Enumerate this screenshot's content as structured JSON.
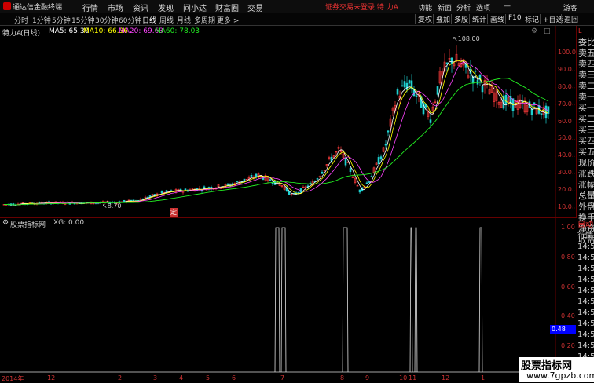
{
  "app": {
    "title": "通达信金融终端"
  },
  "menu": [
    "行情",
    "市场",
    "资讯",
    "发现",
    "问小达",
    "财富圈",
    "交易"
  ],
  "notice": "证券交易未登录   特 力A",
  "right_menu": [
    "功能",
    "新面",
    "分析",
    "选项",
    "游客"
  ],
  "periods": [
    "分时",
    "1分钟",
    "5分钟",
    "15分钟",
    "30分钟",
    "60分钟",
    "日线",
    "周线",
    "月线",
    "多周期",
    "更多 >"
  ],
  "active_period": "日线",
  "toolbar_buttons": [
    "复权",
    "叠加",
    "多股",
    "统计",
    "画线",
    "F10",
    "标记",
    "+自选",
    "返回"
  ],
  "stock": {
    "name": "特力A",
    "period": "(日线)"
  },
  "ma": [
    {
      "label": "MA5: 65.30",
      "color": "#ffffff"
    },
    {
      "label": "MA10: 66.36",
      "color": "#ffff00"
    },
    {
      "label": "MA20: 69.63",
      "color": "#ff44ff"
    },
    {
      "label": "MA60: 78.03",
      "color": "#22ee22"
    }
  ],
  "price_axis": [
    "100.0",
    "90.0",
    "80.0",
    "70.0",
    "60.0",
    "50.0",
    "40.0",
    "30.0",
    "20.0",
    "10.0"
  ],
  "annotations": {
    "high": "108.00",
    "low": "8.70",
    "marker": "定"
  },
  "right_panel": [
    "L",
    "委比",
    "卖五",
    "卖四",
    "卖三",
    "卖二",
    "卖一",
    "买一",
    "买二",
    "买三",
    "买四",
    "买五",
    "现价",
    "涨跌",
    "涨幅",
    "总量",
    "外盘",
    "换手",
    "净资",
    "收益"
  ],
  "right_panel2": [
    "自动",
    "行情",
    "14:56",
    "14:56",
    "14:56",
    "14:56",
    "14:56",
    "14:56",
    "14:56",
    "14:56",
    "14:56",
    "14:56",
    "14:5"
  ],
  "indicator": {
    "name": "股票指标网",
    "value": "XG: 0.00",
    "box_value": "0.48"
  },
  "ind_axis": [
    "1.00",
    "0.80",
    "0.60",
    "0.40",
    "0.20"
  ],
  "dates": [
    "2014年",
    "12",
    "2",
    "3",
    "4",
    "5",
    "6",
    "7",
    "8",
    "9",
    "10",
    "11",
    "12",
    "1",
    "2"
  ],
  "watermark": {
    "line1": "股票指标网",
    "line2": "www.7gpzb.com"
  }
}
